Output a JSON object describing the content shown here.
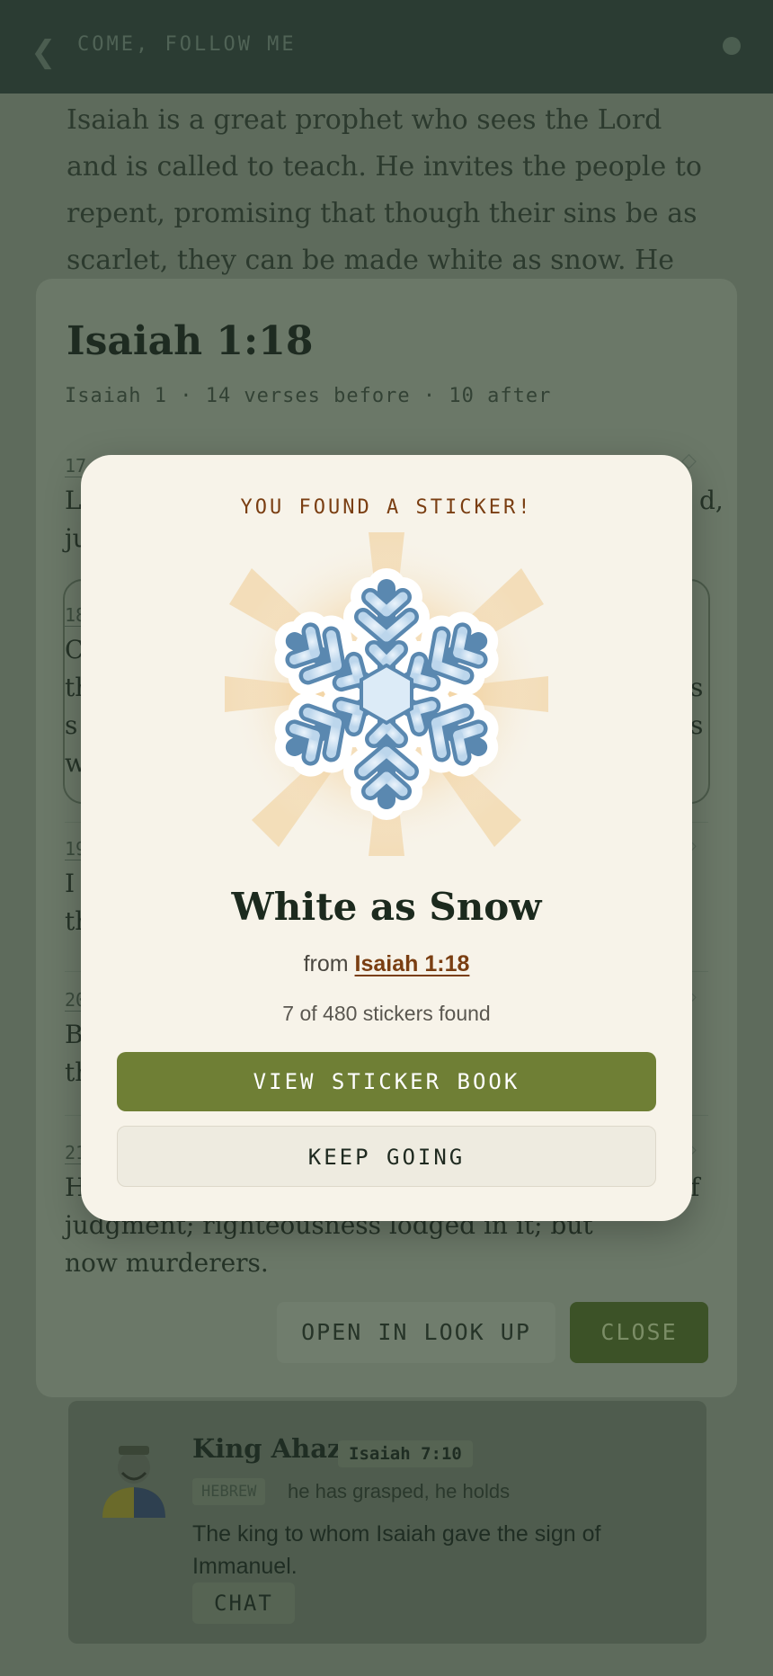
{
  "header": {
    "back_icon": "chevron-left-icon",
    "title": "COME, FOLLOW ME",
    "status_icon": "dot-icon"
  },
  "intro_text": "Isaiah is a great prophet who sees the Lord and is called to teach. He invites the people to repent, promising that though their sins be as scarlet, they can be made white as snow. He",
  "sheet": {
    "title": "Isaiah 1:18",
    "subtitle": "Isaiah 1 · 14 verses before · 10 after",
    "verses": [
      {
        "num": "17",
        "text": "L"
      },
      {
        "num": "18",
        "text": "C"
      },
      {
        "num": "19",
        "text": "I"
      },
      {
        "num": "20",
        "text": "B"
      },
      {
        "num": "21",
        "text": "H"
      }
    ],
    "v17_end": "d,",
    "v17_line2": "ju",
    "v18_line2": "th",
    "v18_line3": "s",
    "v18_line4": "w",
    "v18_end2": "s",
    "v18_end3": "s",
    "v19_line2": "th",
    "v20_line2": "th",
    "v21_tail": "f",
    "v21_cont": "judgment; righteousness lodged in it; but now murderers.",
    "open_label": "OPEN IN LOOK UP",
    "close_label": "CLOSE"
  },
  "person": {
    "name": "King Ahaz",
    "ref": "Isaiah 7:10",
    "lang": "HEBREW",
    "meaning": "he has grasped, he holds",
    "desc": "The king to whom Isaiah gave the sign of Immanuel.",
    "chat_label": "CHAT",
    "avatar_icon": "king-avatar-icon"
  },
  "modal": {
    "eyebrow": "YOU FOUND A STICKER!",
    "sticker_icon": "snowflake-icon",
    "sticker_name": "White as Snow",
    "from_prefix": "from",
    "from_ref": "Isaiah 1:18",
    "count_text": "7 of 480 stickers found",
    "primary_label": "VIEW STICKER BOOK",
    "secondary_label": "KEEP GOING"
  },
  "colors": {
    "accent_green": "#6f7f35",
    "link_brown": "#7a3e12",
    "modal_bg": "#f7f3e9",
    "snowflake_blue": "#5a88b0"
  }
}
